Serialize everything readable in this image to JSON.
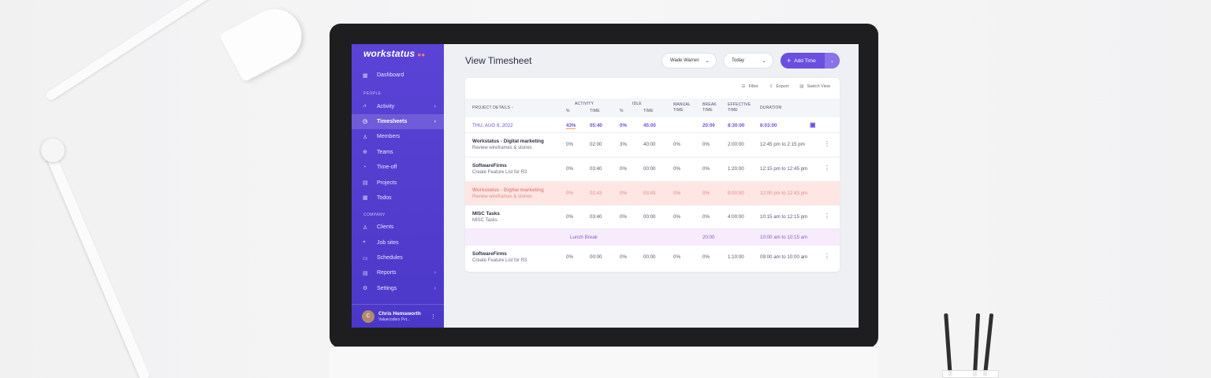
{
  "app": {
    "logo": "workstatus",
    "logo_dots": "●●"
  },
  "sidebar": {
    "items_top": [
      {
        "label": "Dashboard",
        "icon": "dashboard-icon",
        "glyph": "▦"
      }
    ],
    "section_people": "PEOPLE",
    "items_people": [
      {
        "label": "Activity",
        "icon": "activity-icon",
        "glyph": "⩘",
        "chev": "›"
      },
      {
        "label": "Timesheets",
        "icon": "clock-icon",
        "glyph": "◷",
        "chev": "›",
        "active": true
      },
      {
        "label": "Members",
        "icon": "user-icon",
        "glyph": "♙"
      },
      {
        "label": "Teams",
        "icon": "globe-icon",
        "glyph": "⊕"
      },
      {
        "label": "Time-off",
        "icon": "timeoff-icon",
        "glyph": "◔"
      },
      {
        "label": "Projects",
        "icon": "folder-icon",
        "glyph": "▤"
      },
      {
        "label": "Todos",
        "icon": "checklist-icon",
        "glyph": "▦"
      }
    ],
    "section_company": "COMPANY",
    "items_company": [
      {
        "label": "Clients",
        "icon": "client-icon",
        "glyph": "♙"
      },
      {
        "label": "Job sites",
        "icon": "location-icon",
        "glyph": "⌖"
      },
      {
        "label": "Schedules",
        "icon": "calendar-icon",
        "glyph": "▭"
      },
      {
        "label": "Reports",
        "icon": "report-icon",
        "glyph": "▤",
        "chev": "›"
      },
      {
        "label": "Settings",
        "icon": "gear-icon",
        "glyph": "⚙",
        "chev": "›"
      }
    ],
    "profile": {
      "name": "Chris Hemsworth",
      "org": "Valuecoders Pvt...",
      "initial": "C",
      "more": "⋮"
    }
  },
  "header": {
    "title": "View Timesheet",
    "user_select": "Wade Warren",
    "date_select": "Today",
    "add_time": "Add Time",
    "add_glyph": "+",
    "caret": "⌄"
  },
  "toolbar": {
    "filter": "Filter",
    "export": "Export",
    "switch_view": "Switch View"
  },
  "table": {
    "headers": {
      "project_details": "PROJECT DETAILS ↑",
      "activity": "ACTIVITY",
      "idle": "IDLE",
      "pct": "%",
      "time": "TIME",
      "manual": "MANUAL",
      "manual2": "TIME",
      "break": "BREAK",
      "break2": "TIME",
      "effective": "EFFECTIVE",
      "effective2": "TIME",
      "duration": "DURATION"
    },
    "date_row": {
      "date": "THU, AUG 8, 2022",
      "act_pct": "43%",
      "act_time": "05:40",
      "idle_pct": "0%",
      "idle_time": "45:00",
      "break_time": "20:00",
      "effective": "8:30:00",
      "duration": "8:03:00"
    },
    "rows": [
      {
        "name": "Workstatus - Digital marketing",
        "sub": "Review wireframes & stories",
        "act_pct": "0%",
        "act_time": "02:00",
        "idle_pct": "3%",
        "idle_time": "40:00",
        "manual": "0%",
        "break": "0%",
        "effective": "2:00:00",
        "duration": "12:45 pm to 2:15 pm",
        "kind": "normal"
      },
      {
        "name": "SoftwareFirms",
        "sub": "Create Feature List for R3",
        "act_pct": "0%",
        "act_time": "03:40",
        "idle_pct": "0%",
        "idle_time": "00:00",
        "manual": "0%",
        "break": "0%",
        "effective": "1:20:00",
        "duration": "12:15 pm to 12:45 pm",
        "kind": "normal"
      },
      {
        "name": "Workstatus - Digital marketing",
        "sub": "Review wireframes & stories",
        "act_pct": "0%",
        "act_time": "02:43",
        "idle_pct": "0%",
        "idle_time": "03:43",
        "manual": "0%",
        "break": "0%",
        "effective": "9:00:00",
        "duration": "12:00 pm to 12:43 pm",
        "kind": "deleted"
      },
      {
        "name": "MISC Tasks",
        "sub": "MISC Tasks",
        "act_pct": "0%",
        "act_time": "03:40",
        "idle_pct": "0%",
        "idle_time": "00:00",
        "manual": "0%",
        "break": "0%",
        "effective": "4:00:00",
        "duration": "10:15 am to 12:15 pm",
        "kind": "normal"
      }
    ],
    "lunch": {
      "label": "Lunch Break",
      "break_time": "20:00",
      "duration": "10:00 am to 10:15 am"
    },
    "last_row": {
      "name": "SoftwareFirms",
      "sub": "Create Feature List for R3",
      "act_pct": "0%",
      "act_time": "00:00",
      "idle_pct": "0%",
      "idle_time": "00:00",
      "manual": "0%",
      "break": "0%",
      "effective": "1:10:00",
      "duration": "09:00 am to 10:00 am"
    }
  }
}
